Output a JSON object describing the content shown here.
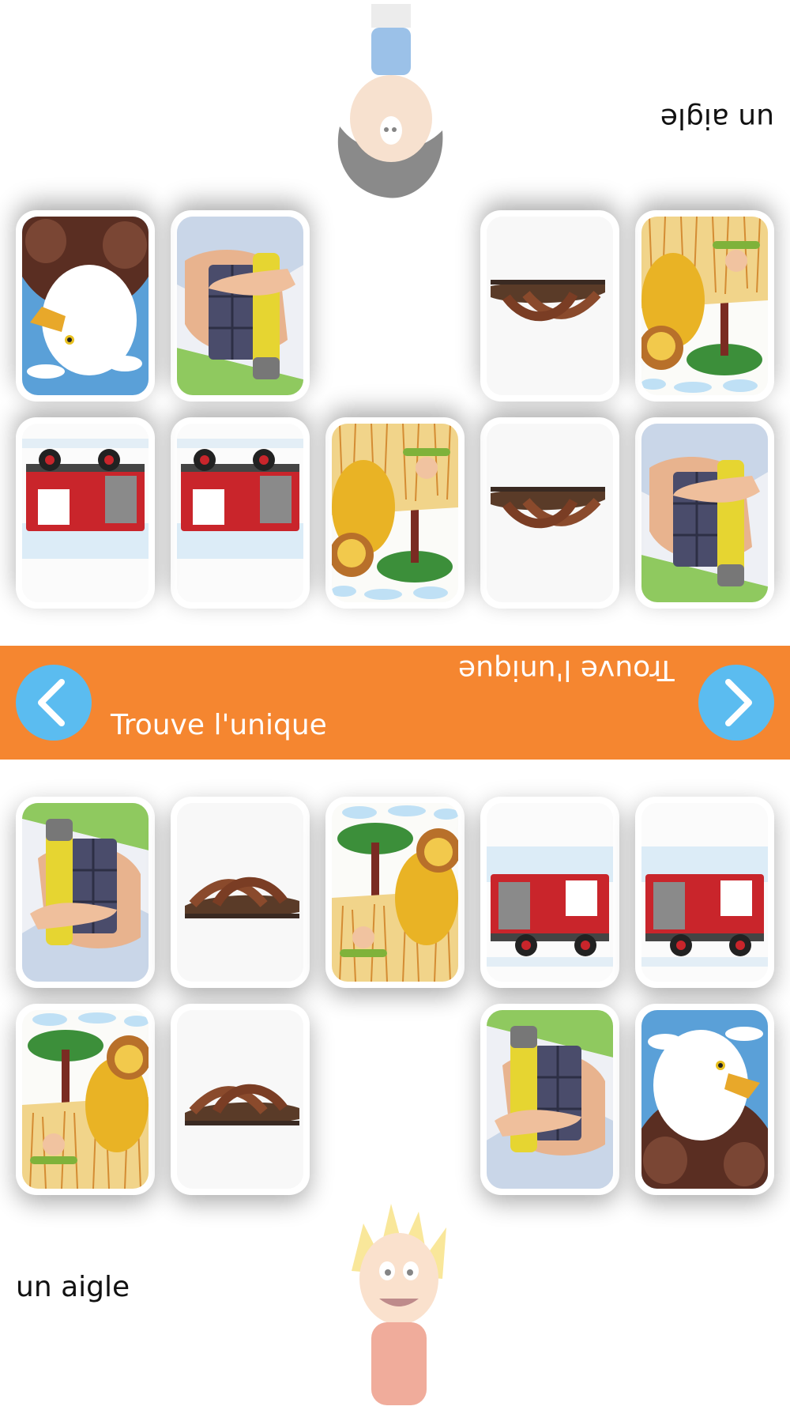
{
  "players": {
    "top": {
      "prompt": "un aigle",
      "avatar": "dark-haired-boy-avatar"
    },
    "bottom": {
      "prompt": "un aigle",
      "avatar": "blond-boy-avatar"
    }
  },
  "banner": {
    "title_left": "Trouve l'unique",
    "title_right": "Trouve l'unique",
    "prev_icon": "chevron-left-icon",
    "next_icon": "chevron-right-icon"
  },
  "board": {
    "bottom_cards": [
      "glue-stick",
      "sandal",
      "tree-lion",
      "fire-truck",
      "fire-truck",
      "tree-lion",
      "sandal",
      "empty",
      "glue-stick",
      "eagle"
    ],
    "top_cards": [
      "glue-stick",
      "sandal",
      "tree-lion",
      "fire-truck",
      "fire-truck",
      "tree-lion",
      "sandal",
      "empty",
      "glue-stick",
      "eagle"
    ]
  },
  "colors": {
    "banner": "#f58630",
    "button": "#5bbcf0",
    "text": "#111111"
  }
}
